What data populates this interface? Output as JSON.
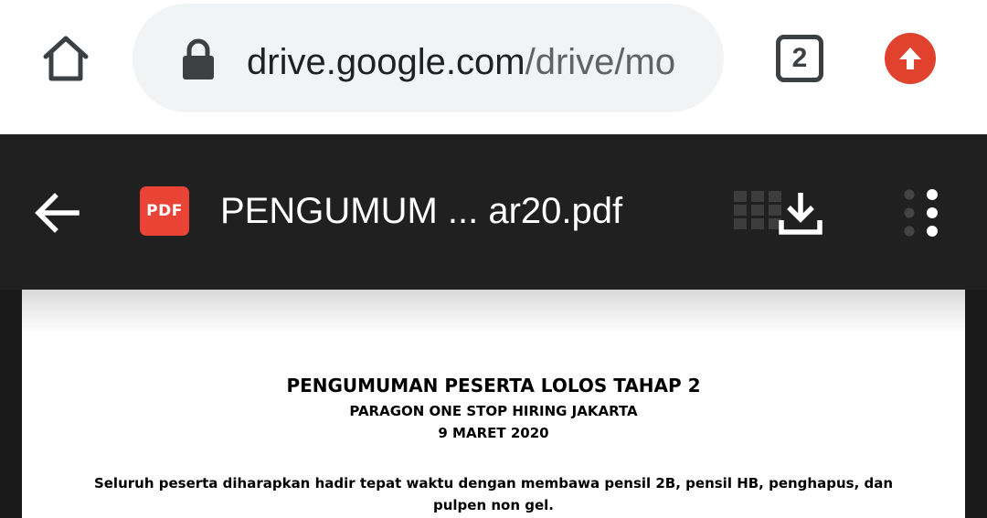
{
  "browser": {
    "url_domain": "drive.google.com",
    "url_path": "/drive/mo",
    "tab_count": "2",
    "icons": {
      "home": "home-icon",
      "lock": "lock-icon",
      "update": "update-arrow-icon"
    },
    "colors": {
      "update_badge": "#e0422e",
      "url_bar": "#f1f3f4"
    }
  },
  "viewer": {
    "file_badge": "PDF",
    "file_title": "PENGUMUM ... ar20.pdf",
    "icons": {
      "back": "arrow-left-icon",
      "grid": "grid-icon",
      "download": "download-icon",
      "more": "more-vertical-icon"
    },
    "colors": {
      "toolbar": "#202020",
      "pdf_badge": "#e94335"
    }
  },
  "document": {
    "title": "PENGUMUMAN PESERTA LOLOS TAHAP 2",
    "subtitle": "PARAGON ONE STOP HIRING JAKARTA",
    "date": "9 MARET 2020",
    "body": "Seluruh peserta diharapkan hadir tepat waktu dengan membawa pensil 2B, pensil HB, penghapus, dan pulpen non gel."
  }
}
